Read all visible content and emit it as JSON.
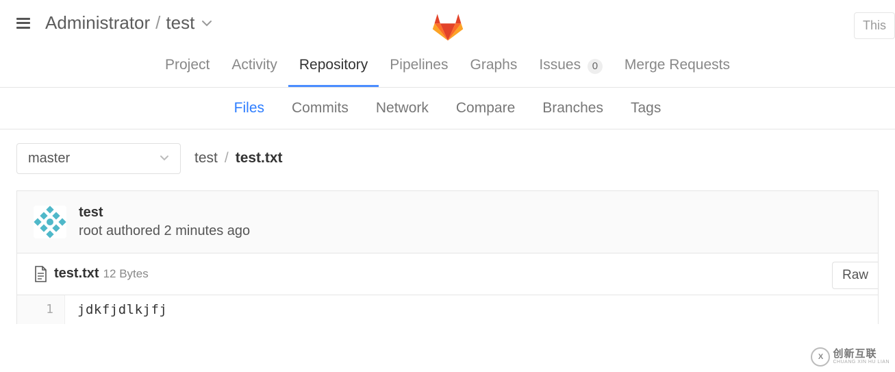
{
  "header": {
    "owner": "Administrator",
    "project": "test"
  },
  "search": {
    "placeholder": "This"
  },
  "main_tabs": [
    {
      "label": "Project"
    },
    {
      "label": "Activity"
    },
    {
      "label": "Repository"
    },
    {
      "label": "Pipelines"
    },
    {
      "label": "Graphs"
    },
    {
      "label": "Issues",
      "count": "0"
    },
    {
      "label": "Merge Requests"
    }
  ],
  "sub_tabs": [
    {
      "label": "Files"
    },
    {
      "label": "Commits"
    },
    {
      "label": "Network"
    },
    {
      "label": "Compare"
    },
    {
      "label": "Branches"
    },
    {
      "label": "Tags"
    }
  ],
  "branch": "master",
  "path": {
    "dir": "test",
    "file": "test.txt"
  },
  "commit": {
    "message": "test",
    "author_line": "root authored 2 minutes ago"
  },
  "file": {
    "name": "test.txt",
    "size": "12 Bytes",
    "raw_label": "Raw"
  },
  "code": {
    "line_num": "1",
    "line_content": "jdkfjdlkjfj"
  },
  "watermark": {
    "big": "创新互联",
    "small": "CHUANG XIN HU LIAN"
  }
}
